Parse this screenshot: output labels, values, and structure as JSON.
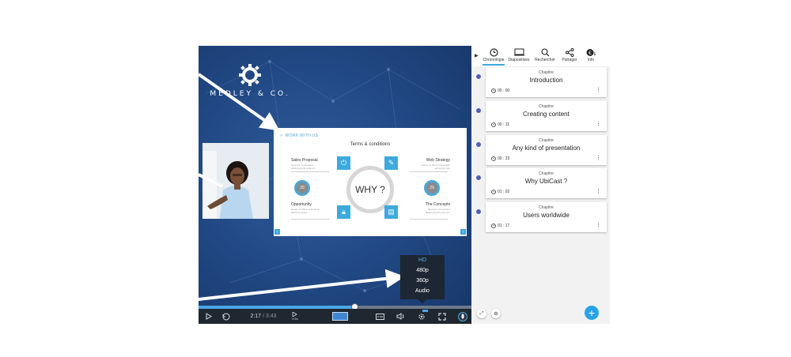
{
  "brand": {
    "name": "MEDLEY & CO."
  },
  "slide": {
    "header": "WORK WITH US",
    "title": "Terms & conditions",
    "center": "WHY ?",
    "items": [
      {
        "label": "Sales Proposal",
        "text": "Sit amet, consectetur adipiscing elit extenum."
      },
      {
        "label": "Web Strategy",
        "text": "Donec ac libero il la sagittis elit tempor elit."
      },
      {
        "label": "Opportunity",
        "text": "Donec ac libero el sit amet faucibus auctor."
      },
      {
        "label": "The Concepts",
        "text": "Sit amet, consectetur adipiscing elit extenum."
      }
    ],
    "ring_left": "29",
    "ring_right": "29"
  },
  "quality_menu": {
    "options": [
      "HD",
      "480p",
      "360p",
      "Audio"
    ],
    "selected": "HD"
  },
  "player": {
    "current_time": "2:17",
    "separator": "/",
    "duration": "3:43",
    "speed": "0.5x",
    "progress": 0.57
  },
  "tabs": [
    {
      "label": "Chronologie",
      "icon": "clock-icon"
    },
    {
      "label": "Diapositives",
      "icon": "slides-icon"
    },
    {
      "label": "Rechercher",
      "icon": "search-icon"
    },
    {
      "label": "Partager",
      "icon": "share-icon"
    },
    {
      "label": "Info",
      "icon": "info-icon"
    }
  ],
  "chapters": [
    {
      "kind": "Chapitre",
      "title": "Introduction",
      "time": "00 : 00"
    },
    {
      "kind": "Chapitre",
      "title": "Creating content",
      "time": "00 : 11"
    },
    {
      "kind": "Chapitre",
      "title": "Any kind of presentation",
      "time": "00 : 23"
    },
    {
      "kind": "Chapitre",
      "title": "Why UbiCast ?",
      "time": "01 : 02"
    },
    {
      "kind": "Chapitre",
      "title": "Users worldwide",
      "time": "01 : 17"
    }
  ],
  "colors": {
    "accent": "#3fa9dc",
    "timeline_dot": "#4f5ebd",
    "player_bg": "#224a86",
    "controls_bg": "#1f2731"
  }
}
